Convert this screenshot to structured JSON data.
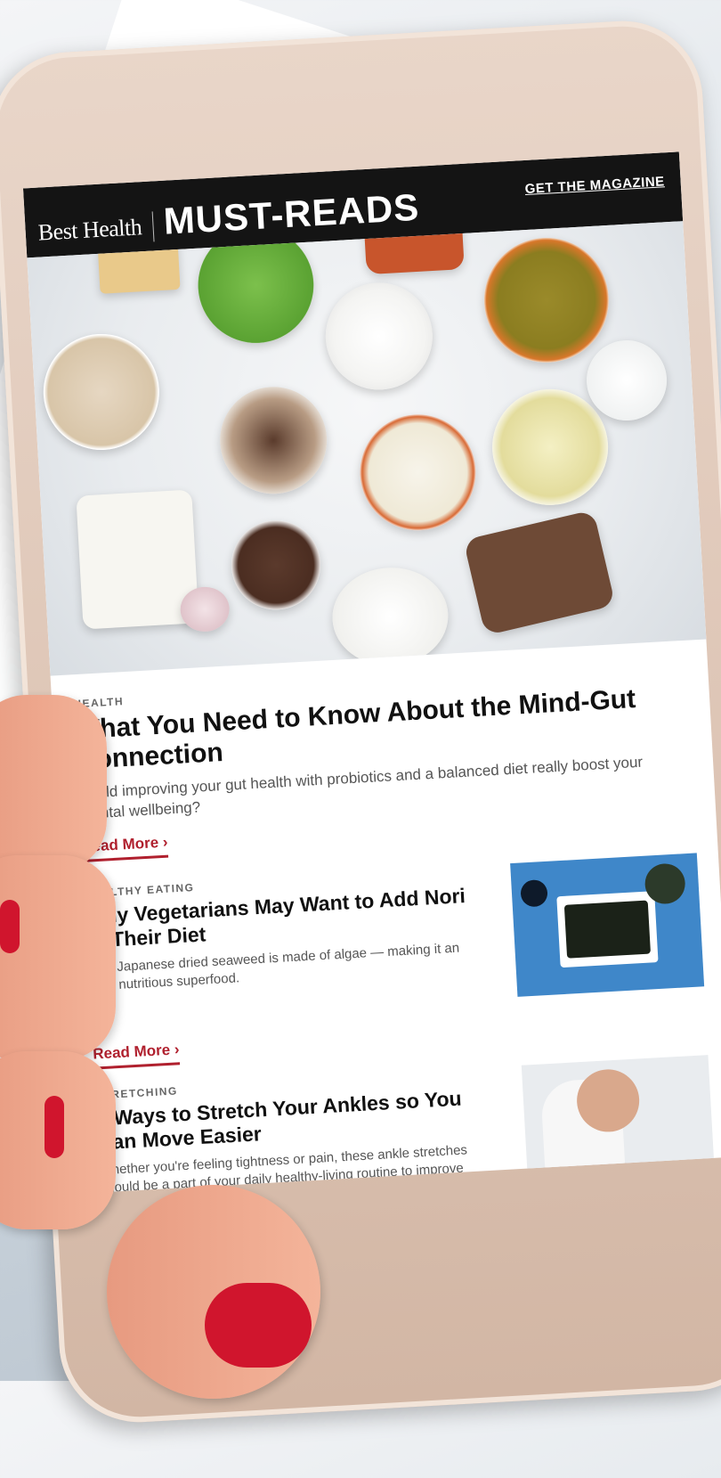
{
  "masthead": {
    "brand": "Best Health",
    "title": "MUST-READS",
    "cta": "GET THE MAGAZINE"
  },
  "featured": {
    "kicker": "HEALTH",
    "headline": "What You Need to Know About the Mind-Gut Connection",
    "dek": "Could improving your gut health with probiotics and a balanced diet really boost your mental wellbeing?",
    "read_more": "Read More ›"
  },
  "articles": [
    {
      "kicker": "HEALTHY EATING",
      "headline": "Why Vegetarians May Want to Add Nori to Their Diet",
      "dek": "This Japanese dried seaweed is made of algae — making it an ultra nutritious superfood.",
      "read_more": "Read More ›"
    },
    {
      "kicker": "STRETCHING",
      "headline": "5 Ways to Stretch Your Ankles so You Can Move Easier",
      "dek": "Whether you're feeling tightness or pain, these ankle stretches should be a part of your daily healthy-living routine to improve mobility."
    }
  ],
  "colors": {
    "masthead_bg": "#141414",
    "accent_red": "#b0202e",
    "nail_red": "#d0152d",
    "phone_body": "#dcc3b3"
  }
}
